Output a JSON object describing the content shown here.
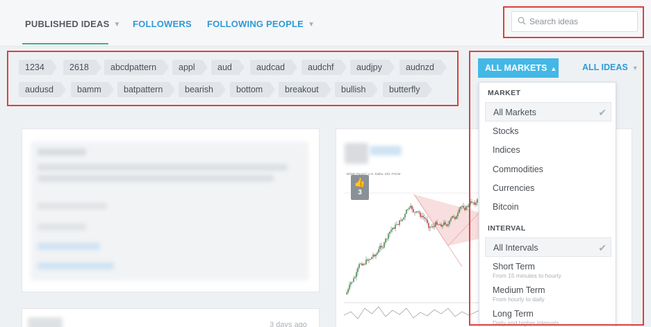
{
  "nav": {
    "tabs": [
      {
        "label": "PUBLISHED IDEAS",
        "has_dropdown": true,
        "active": true
      },
      {
        "label": "FOLLOWERS",
        "has_dropdown": false,
        "active": false
      },
      {
        "label": "FOLLOWING PEOPLE",
        "has_dropdown": true,
        "active": false
      }
    ]
  },
  "search": {
    "placeholder": "Search ideas",
    "icon": "search-icon"
  },
  "tags": {
    "row1": [
      "1234",
      "2618",
      "abcdpattern",
      "appl",
      "aud",
      "audcad",
      "audchf",
      "audjpy",
      "audnzd"
    ],
    "row2": [
      "audusd",
      "bamm",
      "batpattern",
      "bearish",
      "bottom",
      "breakout",
      "bullish",
      "butterfly"
    ]
  },
  "filters": {
    "markets_label": "ALL MARKETS",
    "ideas_label": "ALL IDEAS"
  },
  "dropdown": {
    "market_header": "MARKET",
    "markets": [
      {
        "label": "All Markets",
        "selected": true
      },
      {
        "label": "Stocks",
        "selected": false
      },
      {
        "label": "Indices",
        "selected": false
      },
      {
        "label": "Commodities",
        "selected": false
      },
      {
        "label": "Currencies",
        "selected": false
      },
      {
        "label": "Bitcoin",
        "selected": false
      }
    ],
    "interval_header": "INTERVAL",
    "intervals": [
      {
        "label": "All Intervals",
        "sub": "",
        "selected": true
      },
      {
        "label": "Short Term",
        "sub": "From 15 minutes to hourly",
        "selected": false
      },
      {
        "label": "Medium Term",
        "sub": "From hourly to daily",
        "selected": false
      },
      {
        "label": "Long Term",
        "sub": "Daily and higher intervals",
        "selected": false
      }
    ]
  },
  "idea_card": {
    "likes": "3",
    "chart_title": "British Pound / U.S. Dollar, 240, FXCM"
  },
  "second_card": {
    "time": "3 days ago"
  },
  "colors": {
    "accent_blue": "#43b8e6",
    "link_blue": "#2f9ad6",
    "active_green": "#3cb47a",
    "highlight_red": "#d9413e"
  }
}
